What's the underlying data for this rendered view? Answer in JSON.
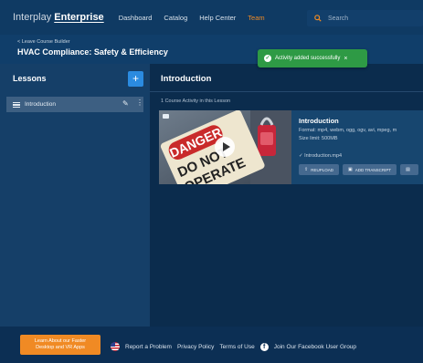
{
  "nav": {
    "brand_light": "Interplay",
    "brand_bold": "Enterprise",
    "links": [
      {
        "label": "Dashboard"
      },
      {
        "label": "Catalog"
      },
      {
        "label": "Help Center"
      },
      {
        "label": "Team"
      }
    ],
    "search_placeholder": "Search",
    "active_color": "#f08a24"
  },
  "header": {
    "breadcrumb": "< Leave Course Builder",
    "course_title": "HVAC Compliance: Safety & Efficiency"
  },
  "toast": {
    "message": "Activity added successfully",
    "check": "✓",
    "close": "×",
    "color": "#2e9a45"
  },
  "sidebar": {
    "title": "Lessons",
    "add_label": "+",
    "lessons": [
      {
        "label": "Introduction"
      }
    ]
  },
  "main": {
    "title": "Introduction",
    "activity_count": "1 Course Activity in this Lesson",
    "activity": {
      "title": "Introduction",
      "format": "Format: mp4, webm, ogg, ogv, avi, mpeg, m",
      "size_limit": "Size limit: 500MB",
      "file": "✓ Introduction.mp4",
      "thumbnail_text": [
        "DANGER",
        "DO NOT",
        "OPERATE"
      ],
      "buttons": [
        {
          "icon": "⇪",
          "label": "REUPLOAD"
        },
        {
          "icon": "▣",
          "label": "ADD TRANSCRIPT"
        },
        {
          "icon": "▤",
          "label": ""
        }
      ]
    }
  },
  "footer": {
    "promo_line1": "Learn About our Faster",
    "promo_line2": "Desktop and VR Apps",
    "links": {
      "report": "Report a Problem",
      "privacy": "Privacy Policy",
      "terms": "Terms of Use",
      "facebook_glyph": "f",
      "facebook": "Join Our Facebook User Group"
    }
  }
}
